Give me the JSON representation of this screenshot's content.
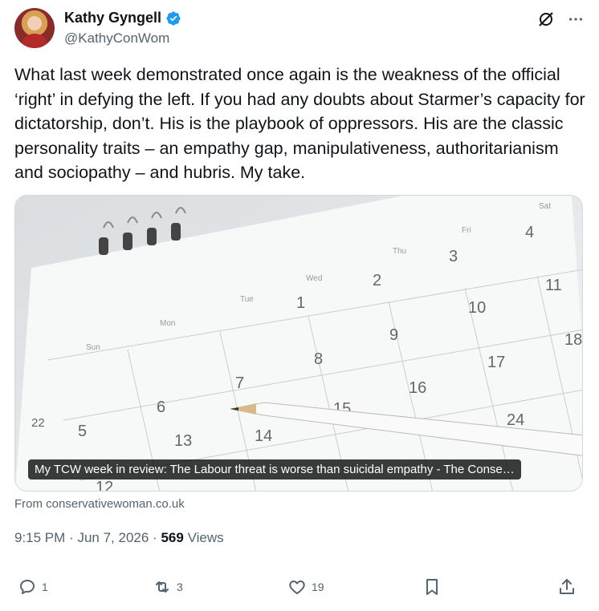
{
  "author": {
    "name": "Kathy Gyngell",
    "handle": "@KathyConWom",
    "verified": true
  },
  "tweet": {
    "text": "What last week demonstrated once again is the weakness of the official ‘right’ in defying the left. If you had any doubts about Starmer’s capacity for dictatorship, don’t. His is the playbook of oppressors. His are the classic personality traits – an empathy gap, manipulativeness, authoritarianism and sociopathy – and hubris. My take."
  },
  "card": {
    "caption": "My TCW week in review: The Labour threat is worse than suicidal empathy - The Conse…",
    "source": "From conservativewoman.co.uk",
    "image_labels": {
      "days": [
        "Sun",
        "Mon",
        "Tue",
        "Wed",
        "Thu",
        "Fri",
        "Sat"
      ],
      "numbers": [
        "1",
        "2",
        "3",
        "4",
        "5",
        "6",
        "7",
        "8",
        "9",
        "10",
        "11",
        "12",
        "13",
        "14",
        "15",
        "16",
        "17",
        "18",
        "22",
        "24"
      ]
    }
  },
  "meta": {
    "time": "9:15 PM",
    "date": "Jun 7, 2026",
    "views_count": "569",
    "views_label": "Views",
    "sep": "·"
  },
  "actions": {
    "replies": "1",
    "reposts": "3",
    "likes": "19"
  },
  "colors": {
    "text": "#0f1419",
    "secondary": "#536471",
    "verified": "#1d9bf0",
    "border": "#cfd9de"
  },
  "icons": [
    "verified-badge-icon",
    "grok-icon",
    "more-icon",
    "reply-icon",
    "repost-icon",
    "like-icon",
    "bookmark-icon",
    "share-icon"
  ]
}
